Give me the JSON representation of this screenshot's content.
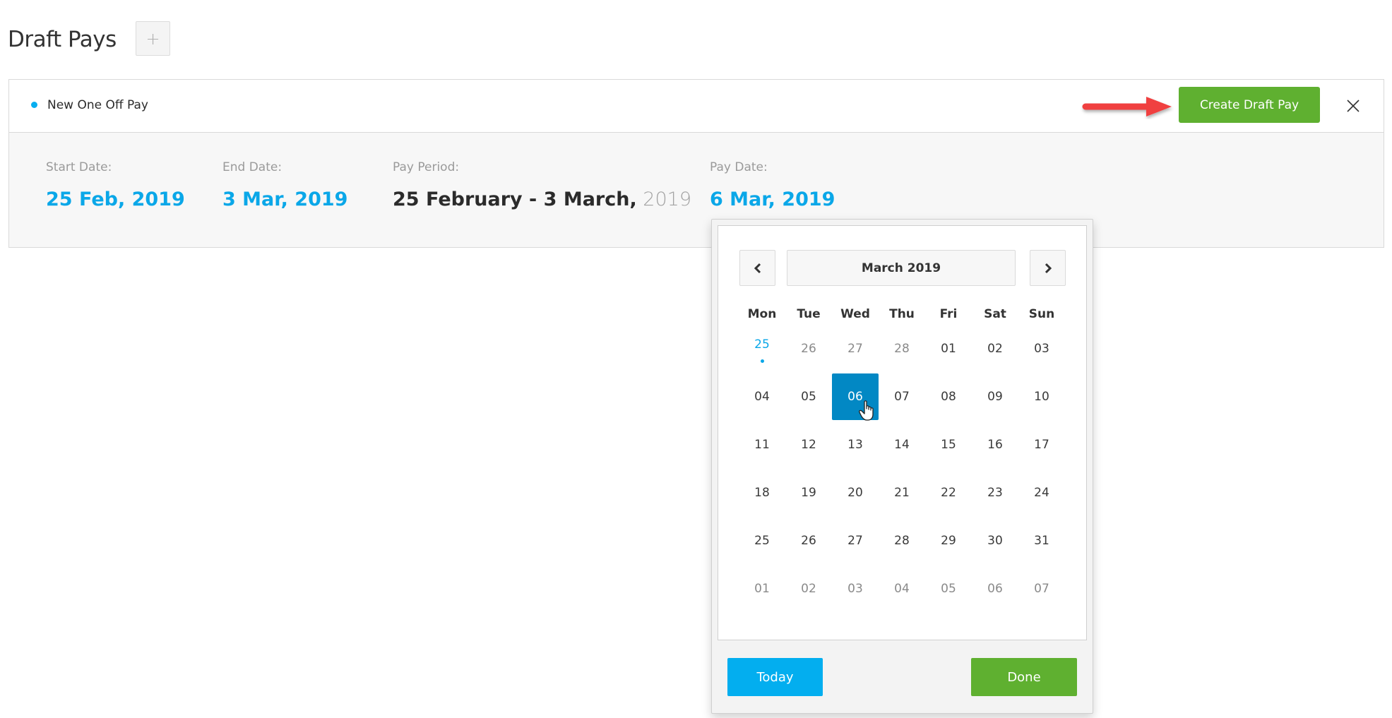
{
  "page": {
    "title": "Draft Pays",
    "add_button_label": "+"
  },
  "draft": {
    "status_color": "#07aef0",
    "name": "New One Off Pay",
    "create_button_label": "Create Draft Pay",
    "close_icon": "close-icon",
    "annotation_icon": "red-arrow-icon",
    "fields": {
      "start_date": {
        "label": "Start Date:",
        "value": "25 Feb, 2019"
      },
      "end_date": {
        "label": "End Date:",
        "value": "3 Mar, 2019"
      },
      "pay_period": {
        "label": "Pay Period:",
        "value": "25 February - 3 March,",
        "year": " 2019"
      },
      "pay_date": {
        "label": "Pay Date:",
        "value": "6 Mar, 2019"
      }
    }
  },
  "calendar": {
    "month_label": "March 2019",
    "prev_icon": "chevron-left-icon",
    "next_icon": "chevron-right-icon",
    "weekdays": [
      "Mon",
      "Tue",
      "Wed",
      "Thu",
      "Fri",
      "Sat",
      "Sun"
    ],
    "weeks": [
      [
        {
          "d": "25",
          "s": "today-marker muted"
        },
        {
          "d": "26",
          "s": "muted"
        },
        {
          "d": "27",
          "s": "muted"
        },
        {
          "d": "28",
          "s": "muted"
        },
        {
          "d": "01",
          "s": ""
        },
        {
          "d": "02",
          "s": ""
        },
        {
          "d": "03",
          "s": ""
        }
      ],
      [
        {
          "d": "04",
          "s": ""
        },
        {
          "d": "05",
          "s": ""
        },
        {
          "d": "06",
          "s": "selected"
        },
        {
          "d": "07",
          "s": ""
        },
        {
          "d": "08",
          "s": ""
        },
        {
          "d": "09",
          "s": ""
        },
        {
          "d": "10",
          "s": ""
        }
      ],
      [
        {
          "d": "11",
          "s": ""
        },
        {
          "d": "12",
          "s": ""
        },
        {
          "d": "13",
          "s": ""
        },
        {
          "d": "14",
          "s": ""
        },
        {
          "d": "15",
          "s": ""
        },
        {
          "d": "16",
          "s": ""
        },
        {
          "d": "17",
          "s": ""
        }
      ],
      [
        {
          "d": "18",
          "s": ""
        },
        {
          "d": "19",
          "s": ""
        },
        {
          "d": "20",
          "s": ""
        },
        {
          "d": "21",
          "s": ""
        },
        {
          "d": "22",
          "s": ""
        },
        {
          "d": "23",
          "s": ""
        },
        {
          "d": "24",
          "s": ""
        }
      ],
      [
        {
          "d": "25",
          "s": ""
        },
        {
          "d": "26",
          "s": ""
        },
        {
          "d": "27",
          "s": ""
        },
        {
          "d": "28",
          "s": ""
        },
        {
          "d": "29",
          "s": ""
        },
        {
          "d": "30",
          "s": ""
        },
        {
          "d": "31",
          "s": ""
        }
      ],
      [
        {
          "d": "01",
          "s": "muted"
        },
        {
          "d": "02",
          "s": "muted"
        },
        {
          "d": "03",
          "s": "muted"
        },
        {
          "d": "04",
          "s": "muted"
        },
        {
          "d": "05",
          "s": "muted"
        },
        {
          "d": "06",
          "s": "muted"
        },
        {
          "d": "07",
          "s": "muted"
        }
      ]
    ],
    "selected_date": "06",
    "today_button_label": "Today",
    "done_button_label": "Done"
  },
  "colors": {
    "accent_blue": "#0aa7e8",
    "selected_blue": "#0288c4",
    "today_button": "#03aeef",
    "success_green": "#5fb030",
    "annotation_red": "#f04040"
  }
}
